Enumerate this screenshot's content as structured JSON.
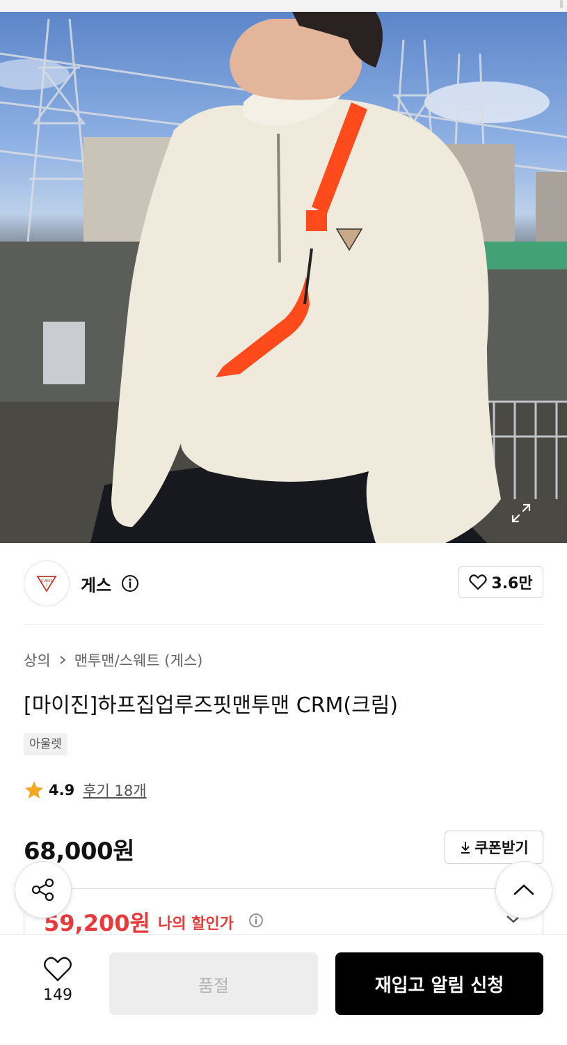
{
  "brand": {
    "name": "게스",
    "likes": "3.6만"
  },
  "breadcrumb": {
    "category": "상의",
    "subcategory": "맨투맨/스웨트 (게스)"
  },
  "product": {
    "title": "[마이진]하프집업루즈핏맨투맨 CRM(크림)",
    "tag": "아울렛",
    "rating": "4.9",
    "reviews": "후기 18개",
    "price": "68,000원",
    "coupon_label": "쿠폰받기",
    "discount_price": "59,200원",
    "discount_label": "나의 할인가"
  },
  "bottom_bar": {
    "wish_count": "149",
    "soldout_label": "품절",
    "restock_label": "재입고 알림 신청"
  },
  "colors": {
    "accent_red": "#e83a3a",
    "star": "#f5a623",
    "primary_button": "#000000"
  },
  "icons": [
    "expand-icon",
    "guess-logo",
    "info-icon",
    "heart-icon",
    "chevron-right-icon",
    "star-icon",
    "download-icon",
    "chevron-down-icon",
    "share-icon",
    "chevron-up-icon"
  ]
}
